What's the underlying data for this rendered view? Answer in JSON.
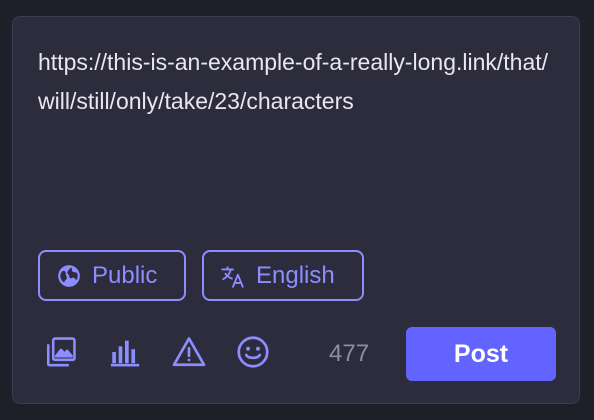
{
  "composer": {
    "text": "https://this-is-an-example-of-a-really-long.link/that/will/still/only/take/23/characters",
    "visibility": {
      "label": "Public",
      "icon": "globe-icon"
    },
    "language": {
      "label": "English",
      "icon": "translate-icon"
    },
    "tools": [
      {
        "name": "add-media",
        "icon": "image-icon"
      },
      {
        "name": "add-poll",
        "icon": "poll-icon"
      },
      {
        "name": "content-warning",
        "icon": "warning-icon"
      },
      {
        "name": "emoji",
        "icon": "emoji-icon"
      }
    ],
    "characters_remaining": "477",
    "post_label": "Post"
  },
  "colors": {
    "page_background": "#1f1f29",
    "panel_background": "#2d2c3d",
    "accent": "#8c8dff",
    "button": "#6364ff",
    "text": "#e8e6f0",
    "muted": "#8e8da3"
  }
}
